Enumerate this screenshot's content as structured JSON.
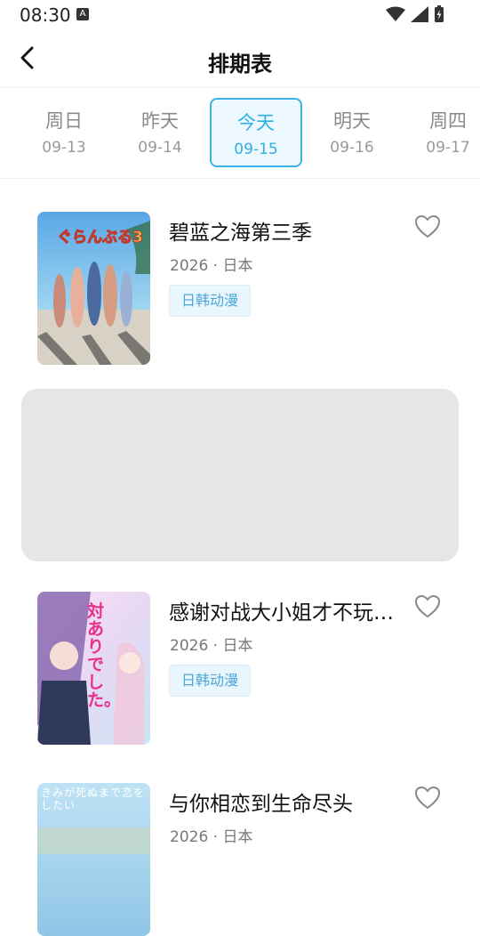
{
  "status_bar": {
    "time": "08:30",
    "notification_letter": "A"
  },
  "header": {
    "title": "排期表"
  },
  "date_tabs": [
    {
      "day": "周日",
      "date": "09-13"
    },
    {
      "day": "昨天",
      "date": "09-14"
    },
    {
      "day": "今天",
      "date": "09-15"
    },
    {
      "day": "明天",
      "date": "09-16"
    },
    {
      "day": "周四",
      "date": "09-17"
    }
  ],
  "active_tab": "今天",
  "anime_list": [
    {
      "title": "碧蓝之海第三季",
      "meta": "2026 · 日本",
      "tag": "日韩动漫",
      "poster_text": "ぐらんぶる3"
    },
    {
      "title": "感谢对战大小姐才不玩…",
      "meta": "2026 · 日本",
      "tag": "日韩动漫",
      "poster_text": "対ありでした。"
    },
    {
      "title": "与你相恋到生命尽头",
      "meta": "2026 · 日本",
      "poster_text": "きみが死ぬまで恋をしたい"
    }
  ],
  "colors": {
    "accent": "#38b4e6",
    "tag_bg": "#eaf6fd",
    "ad_bg": "#e6e6e6"
  }
}
